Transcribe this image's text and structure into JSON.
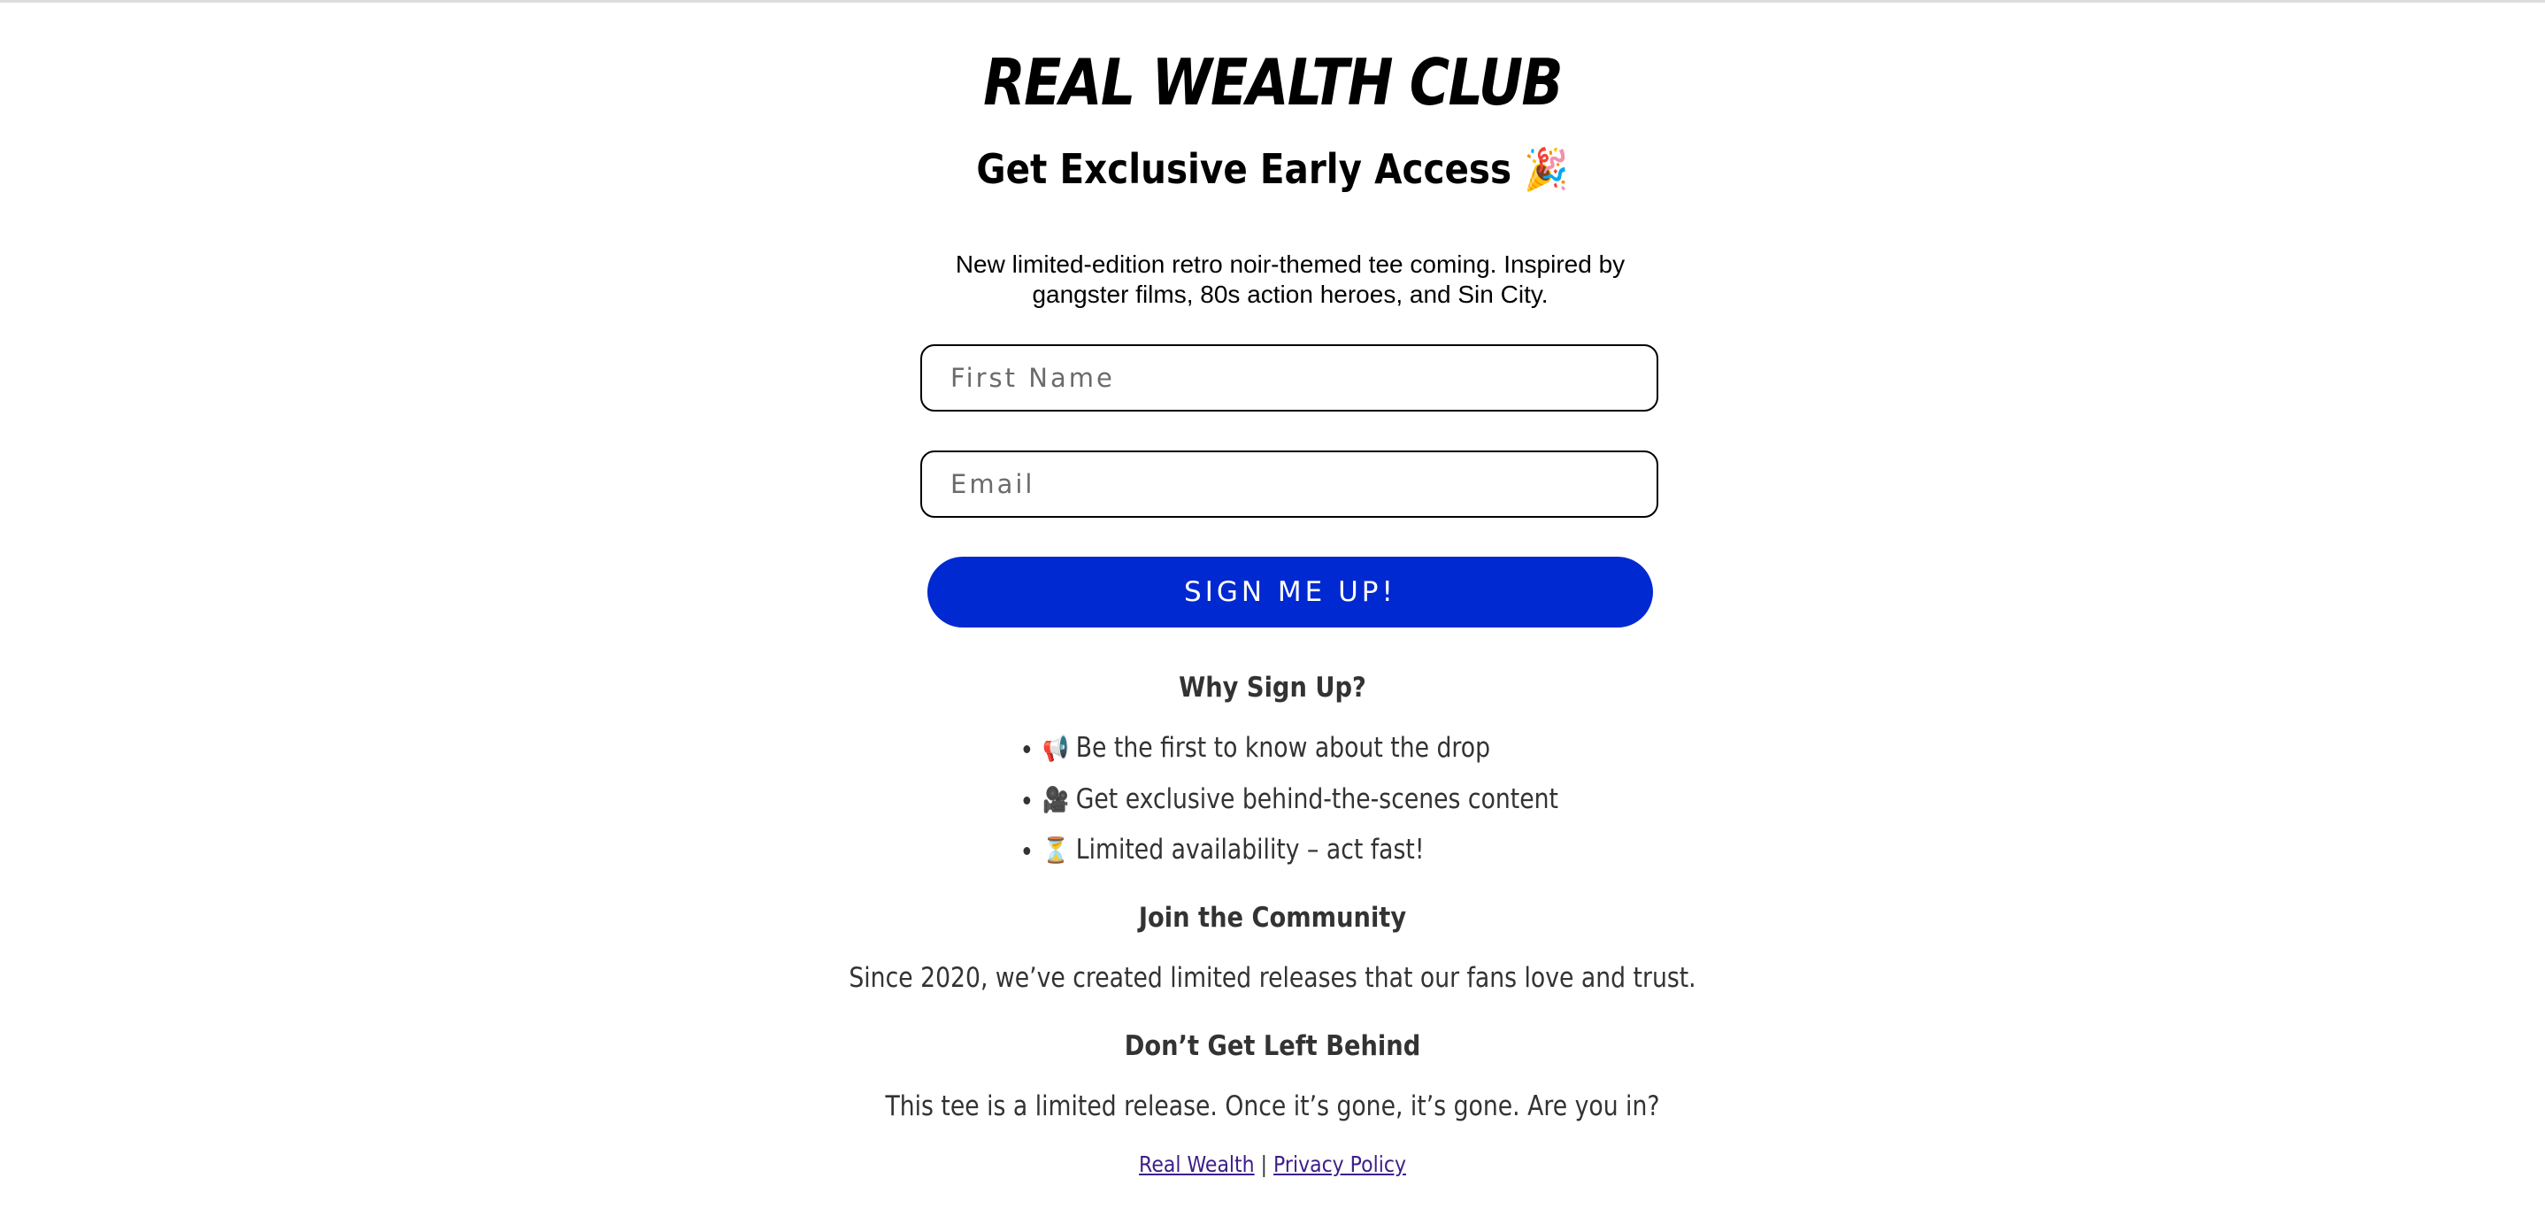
{
  "header": {
    "brand": "REAL WEALTH CLUB",
    "headline": "Get Exclusive Early Access 🎉"
  },
  "intro": {
    "text": "New limited-edition retro noir-themed tee coming. Inspired by gangster films, 80s action heroes, and Sin City."
  },
  "form": {
    "first_name_placeholder": "First Name",
    "email_placeholder": "Email",
    "submit_label": "SIGN ME UP!",
    "submit_color": "#0029d1"
  },
  "why": {
    "title": "Why Sign Up?",
    "items": [
      {
        "icon": "📢",
        "icon_name": "megaphone-icon",
        "text": "Be the first to know about the drop"
      },
      {
        "icon": "🎥",
        "icon_name": "movie-camera-icon",
        "text": "Get exclusive behind-the-scenes content"
      },
      {
        "icon": "⏳",
        "icon_name": "hourglass-icon",
        "text": "Limited availability – act fast!"
      }
    ]
  },
  "community": {
    "title": "Join the Community",
    "text": "Since 2020, we’ve created limited releases that our fans love and trust."
  },
  "urgency": {
    "title": "Don’t Get Left Behind",
    "text": "This tee is a limited release. Once it’s gone, it’s gone. Are you in?"
  },
  "footer": {
    "link1": "Real Wealth",
    "separator": "|",
    "link2": "Privacy Policy",
    "link_color": "#3d1d8a"
  }
}
